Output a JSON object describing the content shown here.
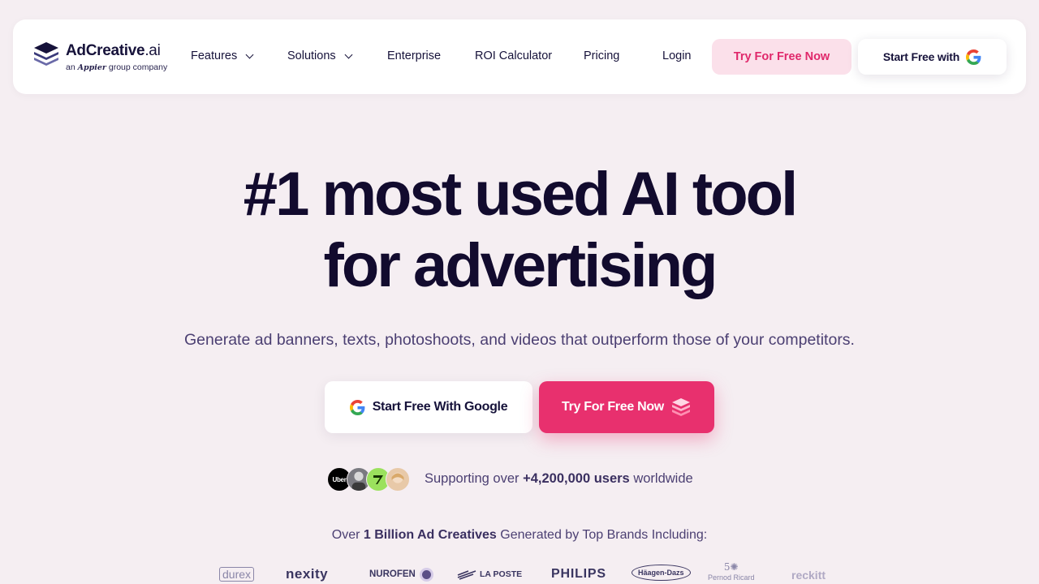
{
  "nav": {
    "logo_name": "AdCreative",
    "logo_suffix": ".ai",
    "logo_sub_prefix": "an",
    "logo_sub_brand": "Appier",
    "logo_sub_suffix": "group company",
    "items": [
      {
        "label": "Features",
        "dropdown": true
      },
      {
        "label": "Solutions",
        "dropdown": true
      },
      {
        "label": "Enterprise"
      },
      {
        "label": "ROI Calculator"
      },
      {
        "label": "Pricing"
      },
      {
        "label": "Login"
      }
    ],
    "try_label": "Try For Free Now",
    "google_label": "Start Free with"
  },
  "hero": {
    "title_line1": "#1 most used AI tool",
    "title_line2": "for advertising",
    "subtitle": "Generate ad banners, texts, photoshoots, and videos that outperform those of your competitors.",
    "google_button": "Start Free With Google",
    "try_button": "Try For Free Now"
  },
  "users": {
    "avatar_uber": "Uber",
    "prefix": "Supporting over ",
    "count": "+4,200,000 users",
    "suffix": " worldwide"
  },
  "brands": {
    "prefix": "Over ",
    "highlight": "1 Billion Ad Creatives",
    "suffix": " Generated by Top Brands Including:",
    "logos": [
      "durex",
      "nexity",
      "NUROFEN",
      "LA POSTE",
      "PHILIPS",
      "Häagen-Dazs",
      "Pernod Ricard",
      "reckitt"
    ]
  },
  "colors": {
    "background": "#f5eef2",
    "accent_pink": "#e8306e",
    "nav_try_bg": "#fbe0ea",
    "text_dark": "#120b2e"
  }
}
